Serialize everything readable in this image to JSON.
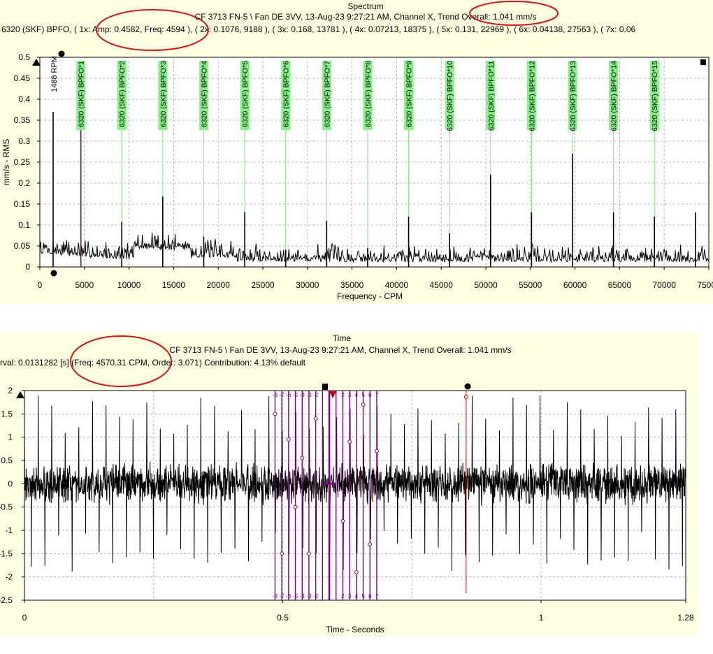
{
  "spectrum": {
    "title": "Spectrum",
    "subtitle": "CF 3713 FN-5 \\ Fan DE 3VV, 13-Aug-23 9:27:21 AM, Channel X, Trend Overall: 1.041 mm/s",
    "info_line": "6320 (SKF) BPFO, ( 1x:  Amp: 0.4582, Freq: 4594 ),  ( 2x:  0.1076, 9188 ),  ( 3x:  0.168, 13781 ),  ( 4x:  0.07213, 18375 ),  ( 5x:  0.131, 22969 ),  ( 6x:  0.04138, 27563 ),  ( 7x:  0.06",
    "rpm_label": "1488 RPM",
    "ylabel": "mm/s - RMS",
    "xlabel": "Frequency - CPM",
    "colors": {
      "panel": "#ffffe1",
      "marker_label_bg": "#86f086",
      "marker_line": "#86e386",
      "signal": "#000000",
      "cursor": "#d01010",
      "annotation": "#d01818"
    }
  },
  "time": {
    "title": "Time",
    "subtitle": "CF 3713 FN-5 \\ Fan DE 3VV, 13-Aug-23 9:27:21 AM, Channel X, Trend Overall: 1.041 mm/s",
    "info_line": "rval: 0.0131282 [s] (Freq: 4570.31 CPM, Order: 3.071)    Contribution: 4.13%    default",
    "xlabel": "Time - Seconds",
    "colors": {
      "panel": "#ffffe1",
      "harmonic_cursor": "#800080",
      "signal": "#000000",
      "cursor": "#c00000"
    }
  },
  "chart_data": [
    {
      "type": "line",
      "title": "Spectrum",
      "xlabel": "Frequency - CPM",
      "ylabel": "mm/s - RMS",
      "xlim": [
        0,
        75000
      ],
      "ylim": [
        0,
        0.5
      ],
      "xticks": [
        0,
        5000,
        10000,
        15000,
        20000,
        25000,
        30000,
        35000,
        40000,
        45000,
        50000,
        55000,
        60000,
        65000,
        70000,
        75000
      ],
      "yticks": [
        0,
        0.05,
        0.1,
        0.15,
        0.2,
        0.25,
        0.3,
        0.35,
        0.4,
        0.45,
        0.5
      ],
      "grid": true,
      "peaks": [
        {
          "x": 1488,
          "y": 0.37
        },
        {
          "x": 4594,
          "y": 0.4582
        },
        {
          "x": 9188,
          "y": 0.1076
        },
        {
          "x": 13781,
          "y": 0.168
        },
        {
          "x": 18375,
          "y": 0.07213
        },
        {
          "x": 22969,
          "y": 0.131
        },
        {
          "x": 27563,
          "y": 0.04138
        },
        {
          "x": 32156,
          "y": 0.11
        },
        {
          "x": 36750,
          "y": 0.045
        },
        {
          "x": 41344,
          "y": 0.12
        },
        {
          "x": 45938,
          "y": 0.08
        },
        {
          "x": 50531,
          "y": 0.22
        },
        {
          "x": 55125,
          "y": 0.13
        },
        {
          "x": 59719,
          "y": 0.27
        },
        {
          "x": 64313,
          "y": 0.13
        },
        {
          "x": 68906,
          "y": 0.12
        },
        {
          "x": 73500,
          "y": 0.13
        }
      ],
      "markers": [
        {
          "label": "6320 (SKF) BPFO*1",
          "x": 4594
        },
        {
          "label": "6320 (SKF) BPFO*2",
          "x": 9188
        },
        {
          "label": "6320 (SKF) BPFO*3",
          "x": 13781
        },
        {
          "label": "6320 (SKF) BPFO*4",
          "x": 18375
        },
        {
          "label": "6320 (SKF) BPFO*5",
          "x": 22969
        },
        {
          "label": "6320 (SKF) BPFO*6",
          "x": 27563
        },
        {
          "label": "6320 (SKF) BPFO*7",
          "x": 32156
        },
        {
          "label": "6320 (SKF) BPFO*8",
          "x": 36750
        },
        {
          "label": "6320 (SKF) BPFO*9",
          "x": 41344
        },
        {
          "label": "6320 (SKF) BPFO*10",
          "x": 45938
        },
        {
          "label": "6320 (SKF) BPFO*11",
          "x": 50531
        },
        {
          "label": "6320 (SKF) BPFO*12",
          "x": 55125
        },
        {
          "label": "6320 (SKF) BPFO*13",
          "x": 59719
        },
        {
          "label": "6320 (SKF) BPFO*14",
          "x": 64313
        },
        {
          "label": "6320 (SKF) BPFO*15",
          "x": 68906
        }
      ]
    },
    {
      "type": "line",
      "title": "Time",
      "xlabel": "Time - Seconds",
      "xlim": [
        0,
        1.28
      ],
      "ylim": [
        -2.5,
        2
      ],
      "xticks": [
        0,
        0.5,
        1,
        1.28
      ],
      "yticks": [
        2,
        1.5,
        1,
        0.5,
        0,
        -0.5,
        -1,
        -1.5,
        -2,
        -2.5
      ],
      "grid": true,
      "impact_period_s": 0.0131282,
      "cursor_time_s": 0.855,
      "harmonic_cursor_center_s": 0.59,
      "harmonic_cursor_labels": [
        "-8",
        "-7",
        "-6",
        "-5",
        "-4",
        "-3",
        "-2",
        "2",
        "3",
        "4",
        "5",
        "6",
        "7"
      ]
    }
  ]
}
